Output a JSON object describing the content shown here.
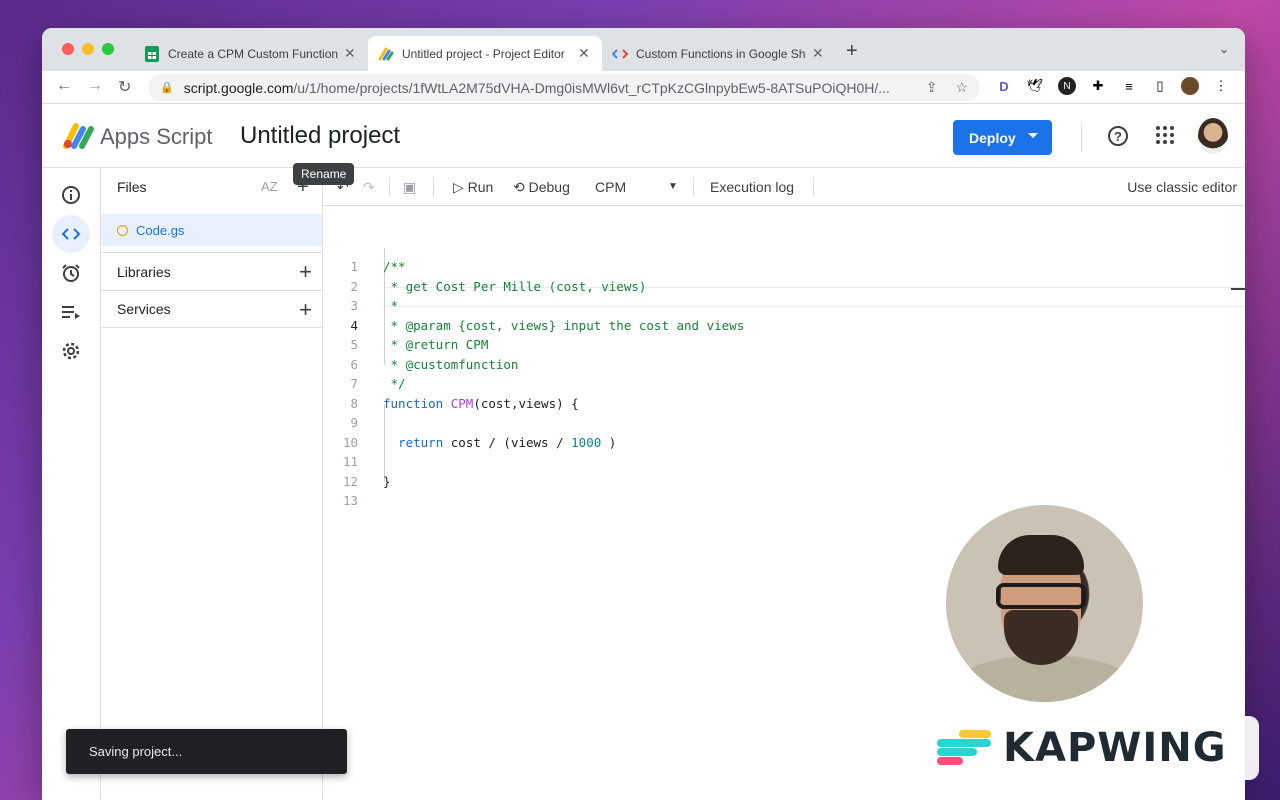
{
  "browser": {
    "tabs": [
      {
        "title": "Create a CPM Custom Function",
        "active": false
      },
      {
        "title": "Untitled project - Project Editor",
        "active": true
      },
      {
        "title": "Custom Functions in Google Sheets",
        "active": false
      }
    ],
    "url_host": "script.google.com",
    "url_path": "/u/1/home/projects/1fWtLA2M75dVHA-Dmg0isMWl6vt_rCTpKzCGlnpybEw5-8ATSuPOiQH0H/..."
  },
  "header": {
    "app_name": "Apps Script",
    "project_name": "Untitled project",
    "deploy_label": "Deploy",
    "tooltip": "Rename"
  },
  "files_panel": {
    "title": "Files",
    "sort_label": "AZ",
    "file_name": "Code.gs",
    "libraries_label": "Libraries",
    "services_label": "Services"
  },
  "editor_toolbar": {
    "run_label": "Run",
    "debug_label": "Debug",
    "function_select": "CPM",
    "execution_log_label": "Execution log",
    "classic_editor_label": "Use classic editor"
  },
  "code": {
    "current_line": 4,
    "lines": [
      "/**",
      " * get Cost Per Mille (cost, views)",
      " *",
      " * @param {cost, views} input the cost and views",
      " * @return CPM",
      " * @customfunction",
      " */",
      "function CPM(cost,views) {",
      "",
      "  return cost / (views / 1000 )",
      "",
      "}",
      ""
    ]
  },
  "toast": {
    "message": "Saving project..."
  },
  "watermark": {
    "text": "KAPWING"
  },
  "colors": {
    "accent": "#1a73e8",
    "comment": "#188038",
    "keyword": "#1967d2",
    "function_name": "#a142f4",
    "number": "#098591"
  }
}
